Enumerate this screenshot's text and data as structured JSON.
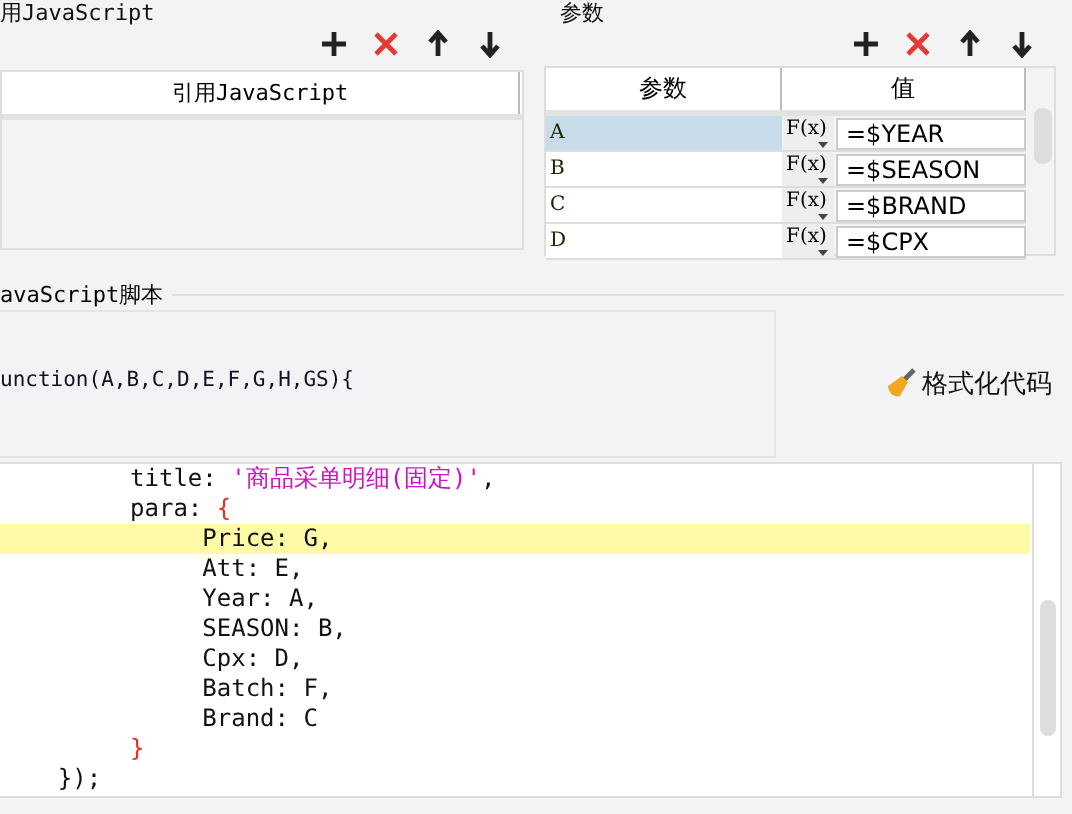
{
  "left_panel": {
    "title": "用JavaScript",
    "toolbar": [
      {
        "kind": "add"
      },
      {
        "kind": "delete"
      },
      {
        "kind": "move-up"
      },
      {
        "kind": "move-down"
      }
    ],
    "table": {
      "columns": [
        "引用JavaScript"
      ]
    }
  },
  "right_panel": {
    "title": "参数",
    "toolbar": [
      {
        "kind": "add"
      },
      {
        "kind": "delete"
      },
      {
        "kind": "move-up"
      },
      {
        "kind": "move-down"
      }
    ],
    "table": {
      "columns": [
        "参数",
        "值"
      ],
      "rows": [
        {
          "name": "A",
          "formula": "F(x)",
          "value": "=$YEAR",
          "selected": true
        },
        {
          "name": "B",
          "formula": "F(x)",
          "value": "=$SEASON",
          "selected": false
        },
        {
          "name": "C",
          "formula": "F(x)",
          "value": "=$BRAND",
          "selected": false
        },
        {
          "name": "D",
          "formula": "F(x)",
          "value": "=$CPX",
          "selected": false
        }
      ]
    }
  },
  "script_section": {
    "title": "avaScript脚本",
    "signature": "unction(A,B,C,D,E,F,G,H,GS){",
    "format_button": "格式化代码"
  },
  "code_editor": {
    "lines": [
      {
        "highlighted": false,
        "tokens": [
          {
            "kind": "plain",
            "text": "         title: "
          },
          {
            "kind": "string",
            "text": "'商品采单明细(固定)'"
          },
          {
            "kind": "plain",
            "text": ","
          }
        ]
      },
      {
        "highlighted": false,
        "tokens": [
          {
            "kind": "plain",
            "text": "         para: "
          },
          {
            "kind": "brace",
            "text": "{"
          }
        ]
      },
      {
        "highlighted": true,
        "tokens": [
          {
            "kind": "plain",
            "text": "              Price: G,"
          }
        ]
      },
      {
        "highlighted": false,
        "tokens": [
          {
            "kind": "plain",
            "text": "              Att: E,"
          }
        ]
      },
      {
        "highlighted": false,
        "tokens": [
          {
            "kind": "plain",
            "text": "              Year: A,"
          }
        ]
      },
      {
        "highlighted": false,
        "tokens": [
          {
            "kind": "plain",
            "text": "              SEASON: B,"
          }
        ]
      },
      {
        "highlighted": false,
        "tokens": [
          {
            "kind": "plain",
            "text": "              Cpx: D,"
          }
        ]
      },
      {
        "highlighted": false,
        "tokens": [
          {
            "kind": "plain",
            "text": "              Batch: F,"
          }
        ]
      },
      {
        "highlighted": false,
        "tokens": [
          {
            "kind": "plain",
            "text": "              Brand: C"
          }
        ]
      },
      {
        "highlighted": false,
        "tokens": [
          {
            "kind": "brace",
            "text": "         }"
          }
        ]
      },
      {
        "highlighted": false,
        "tokens": [
          {
            "kind": "plain",
            "text": "    });"
          }
        ]
      }
    ]
  }
}
